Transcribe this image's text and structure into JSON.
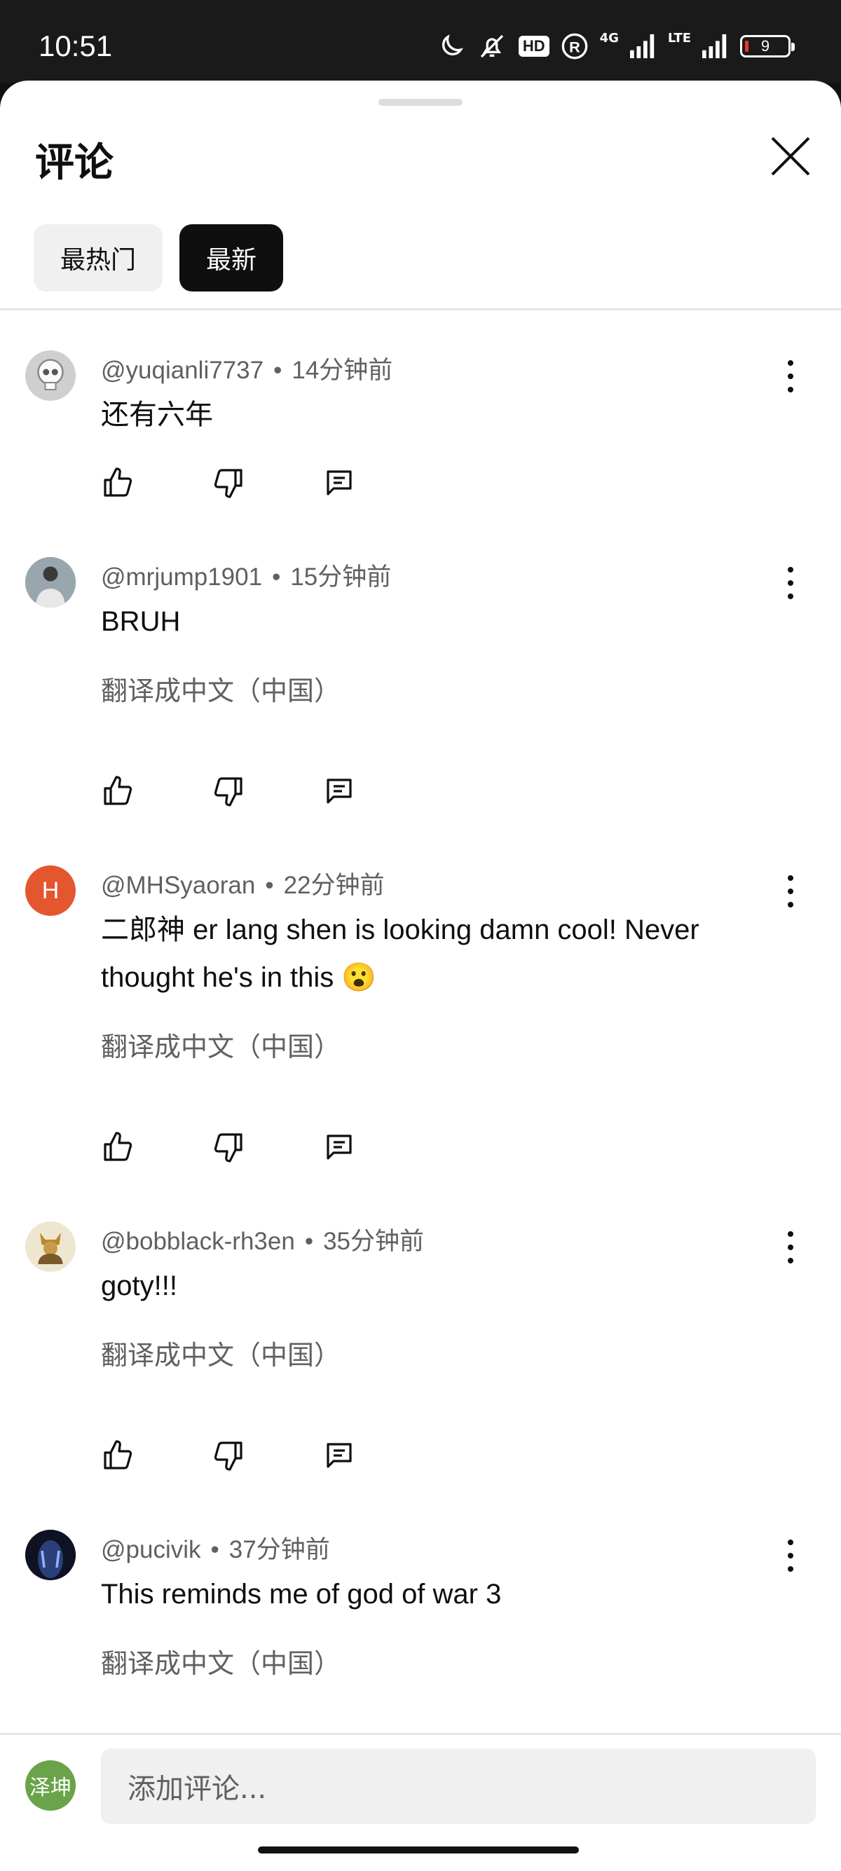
{
  "status_bar": {
    "time": "10:51",
    "hd_label": "HD",
    "net1": "4G",
    "net2": "LTE",
    "battery": "9"
  },
  "sheet": {
    "title": "评论",
    "chips": [
      {
        "label": "最热门",
        "active": false
      },
      {
        "label": "最新",
        "active": true
      }
    ]
  },
  "comments": [
    {
      "author": "@yuqianli7737",
      "time": "14分钟前",
      "text": "还有六年",
      "translate": "",
      "avatar_color": "#cfcfcf",
      "avatar_letter": ""
    },
    {
      "author": "@mrjump1901",
      "time": "15分钟前",
      "text": "BRUH",
      "translate": "翻译成中文（中国）",
      "avatar_color": "#6b7b86",
      "avatar_letter": ""
    },
    {
      "author": "@MHSyaoran",
      "time": "22分钟前",
      "text": "二郎神 er lang shen is looking damn cool! Never thought he's in this  😮",
      "translate": "翻译成中文（中国）",
      "avatar_color": "#e4572e",
      "avatar_letter": "H"
    },
    {
      "author": "@bobblack-rh3en",
      "time": "35分钟前",
      "text": "goty!!!",
      "translate": "翻译成中文（中国）",
      "avatar_color": "#d8c7a0",
      "avatar_letter": ""
    },
    {
      "author": "@pucivik",
      "time": "37分钟前",
      "text": "This reminds me of god of war 3",
      "translate": "翻译成中文（中国）",
      "avatar_color": "#1c2a4a",
      "avatar_letter": ""
    }
  ],
  "composer": {
    "avatar_text": "泽坤",
    "placeholder": "添加评论..."
  },
  "icons": [
    "moon-icon",
    "mute-icon",
    "registered-icon",
    "signal-icon",
    "close-icon",
    "like-icon",
    "dislike-icon",
    "reply-icon",
    "more-icon"
  ]
}
